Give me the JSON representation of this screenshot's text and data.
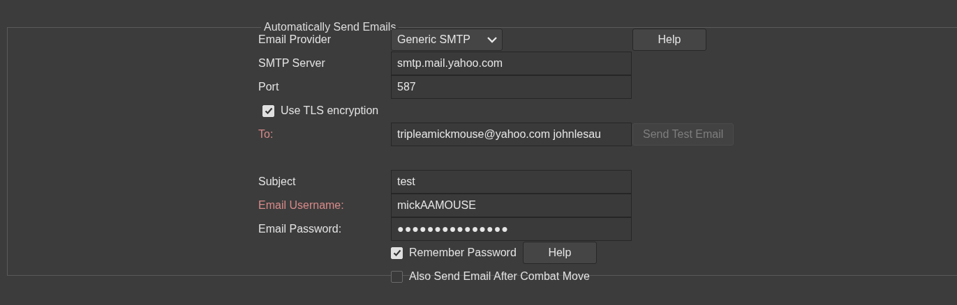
{
  "group": {
    "title": "Automatically Send Emails"
  },
  "provider": {
    "label": "Email Provider",
    "invalid": false,
    "value": "Generic SMTP",
    "help": "Help"
  },
  "server": {
    "label": "SMTP Server",
    "invalid": false,
    "value": "smtp.mail.yahoo.com"
  },
  "port": {
    "label": "Port",
    "invalid": false,
    "value": "587"
  },
  "tls": {
    "label": "Use TLS encryption",
    "checked": true
  },
  "to": {
    "label": "To:",
    "invalid": true,
    "value": "tripleamickmouse@yahoo.com johnlesau",
    "button": "Send Test Email",
    "button_disabled": true
  },
  "subject": {
    "label": "Subject",
    "invalid": false,
    "value": "test"
  },
  "username": {
    "label": "Email Username:",
    "invalid": true,
    "value": "mickAAMOUSE"
  },
  "password": {
    "label": "Email Password:",
    "invalid": false,
    "value": "●●●●●●●●●●●●●●●"
  },
  "remember": {
    "label": "Remember Password",
    "checked": true,
    "help": "Help"
  },
  "combat": {
    "label": "Also Send Email After Combat Move",
    "checked": false
  }
}
